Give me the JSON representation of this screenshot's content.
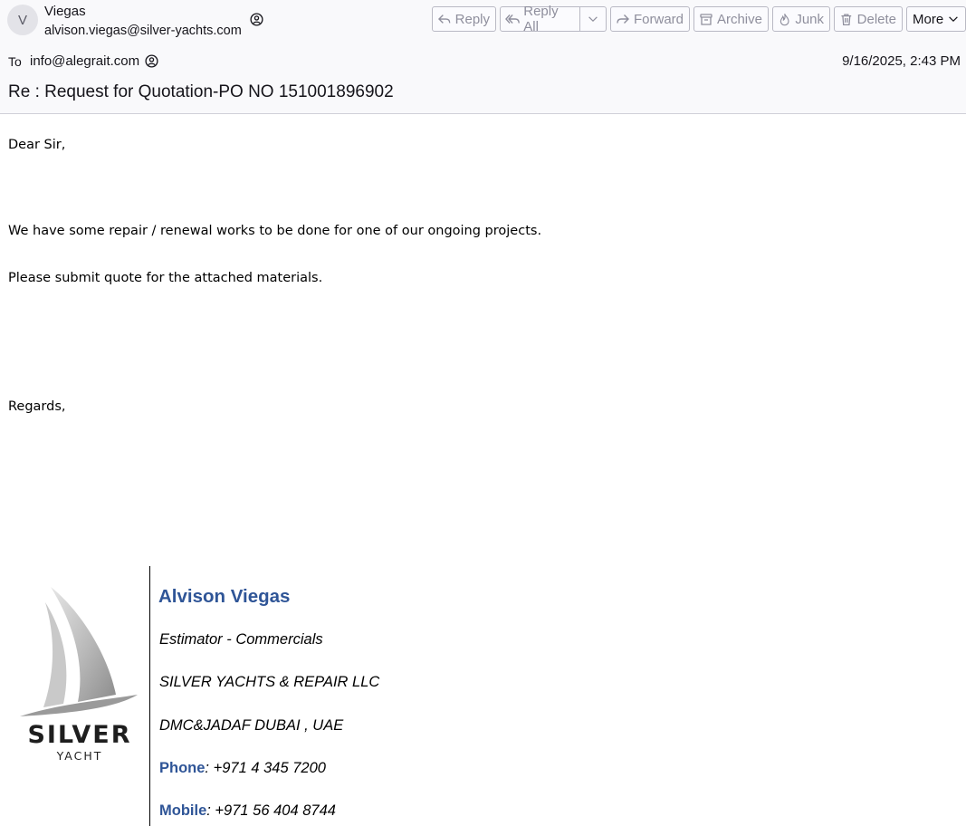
{
  "header": {
    "avatar_initial": "V",
    "sender_name": "Viegas",
    "sender_email": "alvison.viegas@silver-yachts.com",
    "to_label": "To",
    "to_address": "info@alegrait.com",
    "date": "9/16/2025, 2:43 PM",
    "subject": "Re : Request for Quotation-PO NO 151001896902"
  },
  "toolbar": {
    "reply": "Reply",
    "reply_all": "Reply All",
    "forward": "Forward",
    "archive": "Archive",
    "junk": "Junk",
    "delete": "Delete",
    "more": "More"
  },
  "body": {
    "greeting": "Dear Sir,",
    "line1": "We have some repair / renewal works to be done for one of our ongoing projects.",
    "line2": "Please submit quote for  the attached materials.",
    "closing": "Regards,"
  },
  "signature": {
    "name": "Alvison Viegas",
    "title": "Estimator - Commercials",
    "company": "SILVER YACHTS & REPAIR LLC",
    "location": "DMC&JADAF DUBAI , UAE",
    "phone_label": "Phone",
    "phone": ": +971 4 345 7200",
    "mobile_label": "Mobile",
    "mobile": ": +971 56 404 8744",
    "logo_word": "SILVER",
    "logo_sub": "YACHT"
  },
  "colors": {
    "accent": "#2f5597",
    "header_bg": "#f9f9fb",
    "disabled_text": "#8f8f9d"
  }
}
